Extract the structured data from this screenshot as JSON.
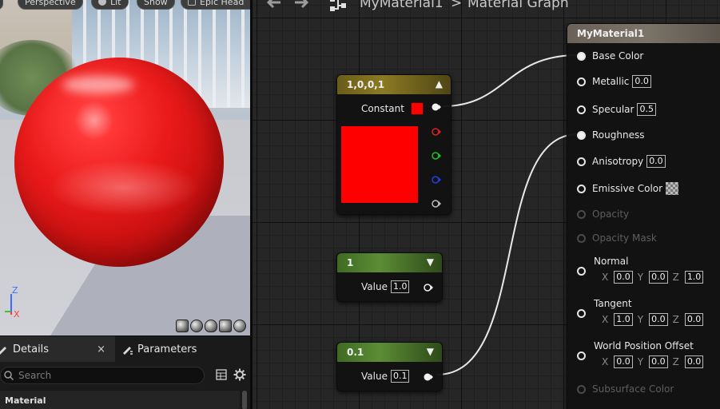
{
  "viewport": {
    "perspective_label": "Perspective",
    "lit_label": "Lit",
    "show_label": "Show",
    "preview_label": "Epic Head",
    "axis_z": "Z",
    "axis_x": "X"
  },
  "details_panel": {
    "tab_details": "Details",
    "tab_close": "×",
    "tab_parameters": "Parameters",
    "search_placeholder": "Search",
    "section_material": "Material"
  },
  "graph": {
    "breadcrumb_material": "MyMaterial1",
    "breadcrumb_separator": ">",
    "breadcrumb_graph": "Material Graph"
  },
  "nodes": {
    "constant3": {
      "title": "1,0,0,1",
      "pin_label": "Constant",
      "color": "#ff0000"
    },
    "scalar_one": {
      "title": "1",
      "pin_label": "Value",
      "value": "1.0"
    },
    "scalar_roughness": {
      "title": "0.1",
      "pin_label": "Value",
      "value": "0.1"
    }
  },
  "material_node": {
    "title": "MyMaterial1",
    "pins": {
      "base_color": "Base Color",
      "metallic": "Metallic",
      "metallic_value": "0.0",
      "specular": "Specular",
      "specular_value": "0.5",
      "roughness": "Roughness",
      "anisotropy": "Anisotropy",
      "anisotropy_value": "0.0",
      "emissive": "Emissive Color",
      "opacity": "Opacity",
      "opacity_mask": "Opacity Mask",
      "normal": "Normal",
      "normal_x": "0.0",
      "normal_y": "0.0",
      "normal_z": "1.0",
      "tangent": "Tangent",
      "tangent_x": "1.0",
      "tangent_y": "0.0",
      "tangent_z": "0.0",
      "wpo": "World Position Offset",
      "wpo_x": "0.0",
      "wpo_y": "0.0",
      "wpo_z": "0.0",
      "subsurface": "Subsurface Color",
      "label_x": "X",
      "label_y": "Y",
      "label_z": "Z"
    }
  },
  "colors": {
    "red_channel": "#e02020",
    "green_channel": "#22c022",
    "blue_channel": "#2040e0",
    "wire": "#e8e8e8"
  }
}
